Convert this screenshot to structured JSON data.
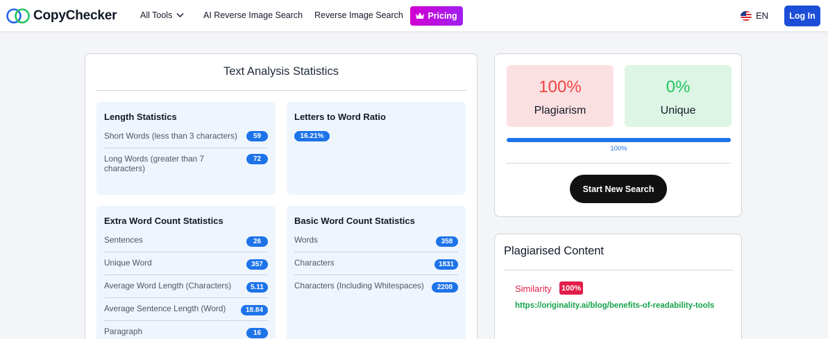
{
  "header": {
    "logo_text": "CopyChecker",
    "nav_all_tools": "All Tools",
    "nav_ai_reverse": "AI Reverse Image Search",
    "nav_reverse": "Reverse Image Search",
    "pricing_label": "Pricing",
    "language": "EN",
    "login_label": "Log In"
  },
  "analysis": {
    "title": "Text Analysis Statistics",
    "length": {
      "title": "Length Statistics",
      "rows": [
        {
          "label": "Short Words (less than 3 characters)",
          "value": "59"
        },
        {
          "label": "Long Words (greater than 7 characters)",
          "value": "72"
        }
      ]
    },
    "ratio": {
      "title": "Letters to Word Ratio",
      "value": "16.21%"
    },
    "extra": {
      "title": "Extra Word Count Statistics",
      "rows": [
        {
          "label": "Sentences",
          "value": "26"
        },
        {
          "label": "Unique Word",
          "value": "357"
        },
        {
          "label": "Average Word Length (Characters)",
          "value": "5.11"
        },
        {
          "label": "Average Sentence Length (Word)",
          "value": "18.84"
        },
        {
          "label": "Paragraph",
          "value": "16"
        }
      ]
    },
    "basic": {
      "title": "Basic Word Count Statistics",
      "rows": [
        {
          "label": "Words",
          "value": "358"
        },
        {
          "label": "Characters",
          "value": "1831"
        },
        {
          "label": "Characters (Including Whitespaces)",
          "value": "2208"
        }
      ]
    }
  },
  "result": {
    "plagiarism_value": "100%",
    "plagiarism_label": "Plagiarism",
    "unique_value": "0%",
    "unique_label": "Unique",
    "progress_percent": 100,
    "progress_text": "100%",
    "start_button": "Start New Search"
  },
  "plagiarised": {
    "title": "Plagiarised Content",
    "similarity_label": "Similarity",
    "similarity_value": "100%",
    "link": "https://originality.ai/blog/benefits-of-readability-tools"
  },
  "colors": {
    "accent_blue": "#1d73e8",
    "plagiarism_red": "#ef4444",
    "unique_green": "#22c55e",
    "link_green": "#16a34a"
  }
}
